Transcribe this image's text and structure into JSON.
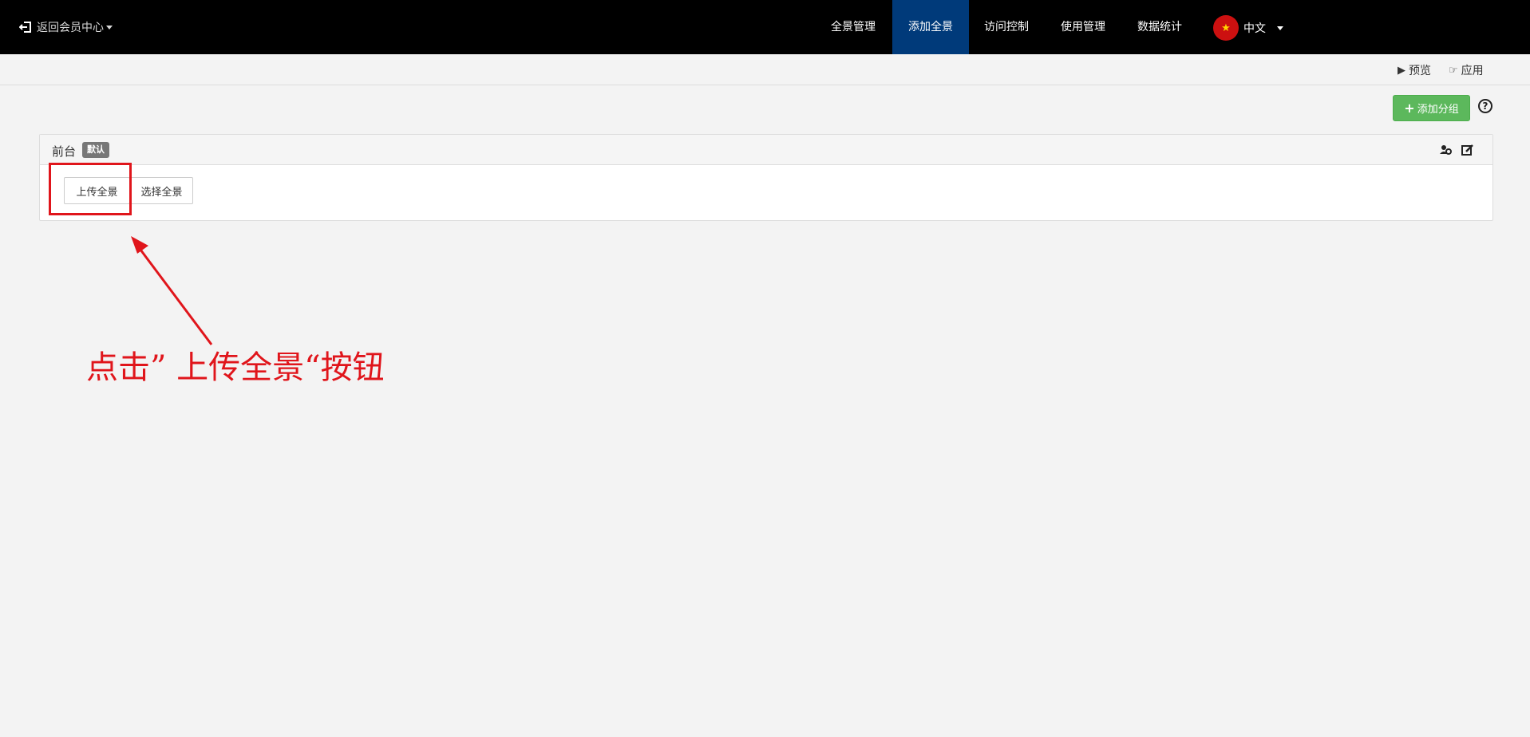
{
  "topbar": {
    "back_label": "返回会员中心",
    "nav": [
      {
        "label": "全景管理",
        "active": false
      },
      {
        "label": "添加全景",
        "active": true
      },
      {
        "label": "访问控制",
        "active": false
      },
      {
        "label": "使用管理",
        "active": false
      },
      {
        "label": "数据统计",
        "active": false
      }
    ],
    "language": "中文",
    "colors": {
      "background": "#000000",
      "active_tab": "#003a7a"
    }
  },
  "subbar": {
    "preview_label": "预览",
    "apply_label": "应用"
  },
  "toolbar": {
    "add_group_label": "添加分组",
    "help_label": "?",
    "add_group_color": "#5cb85c"
  },
  "group": {
    "title": "前台",
    "badge": "默认",
    "upload_button": "上传全景",
    "select_button": "选择全景"
  },
  "annotation": {
    "text": "点击” 上传全景“按钮",
    "color": "#e0151b"
  }
}
